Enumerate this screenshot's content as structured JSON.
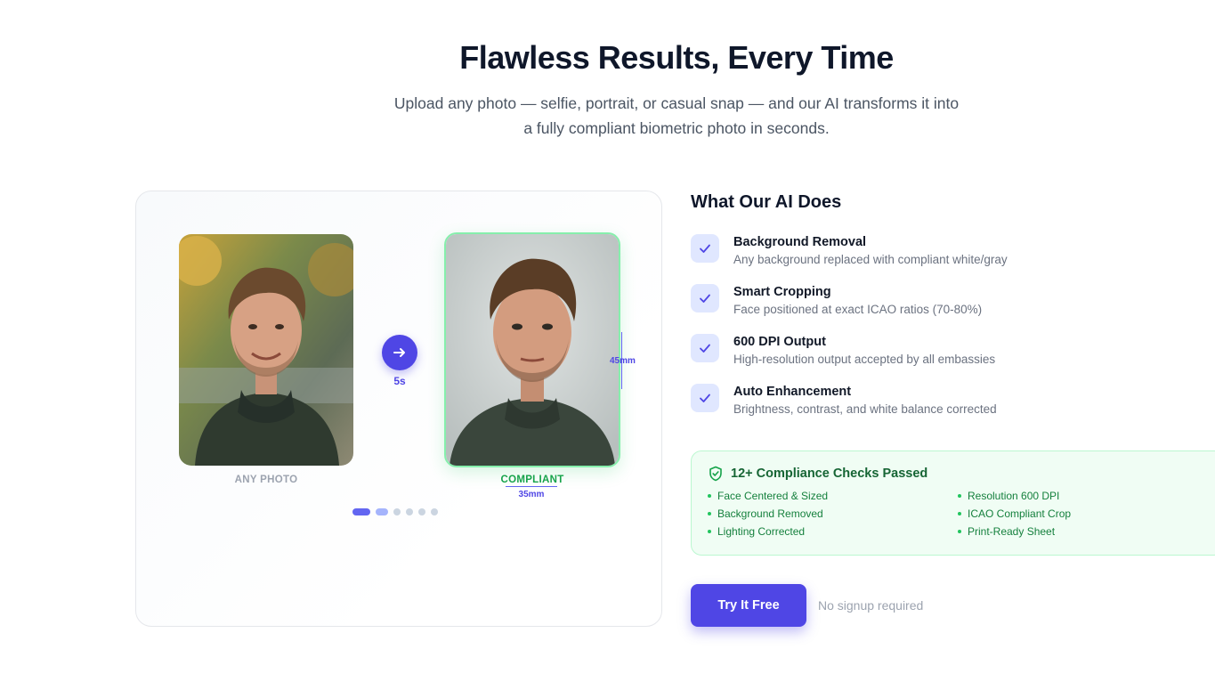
{
  "hero": {
    "title": "Flawless Results, Every Time",
    "subtitle_line1": "Upload any photo — selfie, portrait, or casual snap — and our AI transforms it into",
    "subtitle_line2": "a fully compliant biometric photo in seconds."
  },
  "demo": {
    "before_label": "ANY PHOTO",
    "after_label": "COMPLIANT",
    "transform_time": "5s",
    "width_measure": "35mm",
    "height_measure": "45mm",
    "slide_count": 6,
    "active_slide": 1
  },
  "features": {
    "title": "What Our AI Does",
    "items": [
      {
        "title": "Background Removal",
        "desc": "Any background replaced with compliant white/gray"
      },
      {
        "title": "Smart Cropping",
        "desc": "Face positioned at exact ICAO ratios (70-80%)"
      },
      {
        "title": "600 DPI Output",
        "desc": "High-resolution output accepted by all embassies"
      },
      {
        "title": "Auto Enhancement",
        "desc": "Brightness, contrast, and white balance corrected"
      }
    ]
  },
  "compliance": {
    "title": "12+ Compliance Checks Passed",
    "items": [
      "Face Centered & Sized",
      "Resolution 600 DPI",
      "Background Removed",
      "ICAO Compliant Crop",
      "Lighting Corrected",
      "Print-Ready Sheet"
    ]
  },
  "cta": {
    "button_label": "Try It Free",
    "note": "No signup required"
  },
  "colors": {
    "accent": "#4f46e5",
    "success": "#16a34a",
    "success_bg": "#f0fdf4"
  },
  "icons": [
    "arrow-right-icon",
    "check-icon",
    "shield-check-icon"
  ]
}
